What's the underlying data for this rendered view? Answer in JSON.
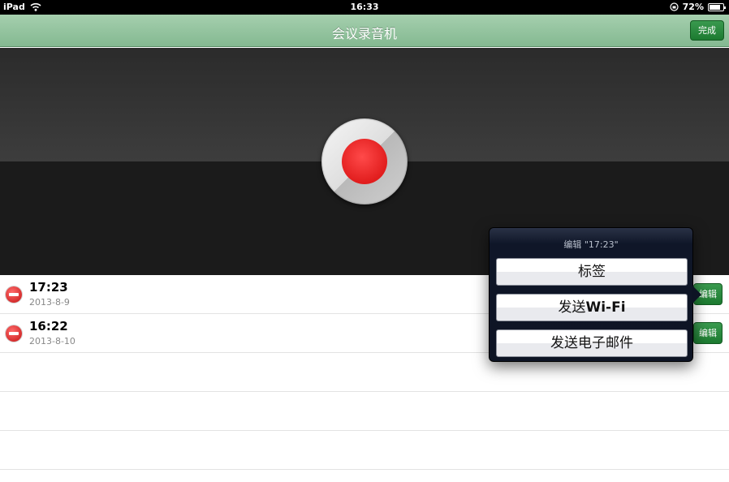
{
  "status_bar": {
    "carrier": "iPad",
    "time": "16:33",
    "battery": "72%"
  },
  "nav": {
    "title": "会议录音机",
    "done_label": "完成"
  },
  "recordings": [
    {
      "title": "17:23",
      "date": "2013-8-9",
      "edit_label": "编辑"
    },
    {
      "title": "16:22",
      "date": "2013-8-10",
      "edit_label": "编辑"
    }
  ],
  "popover": {
    "title": "编辑 \"17:23\"",
    "items": {
      "tag": "标签",
      "send_wifi_prefix": "发送",
      "send_wifi_suffix": "Wi-Fi",
      "send_email": "发送电子邮件"
    }
  },
  "icons": {
    "wifi": "wifi-icon",
    "orientation_lock": "rotation-lock-icon",
    "battery": "battery-icon",
    "record": "record-icon",
    "delete": "delete-icon"
  }
}
